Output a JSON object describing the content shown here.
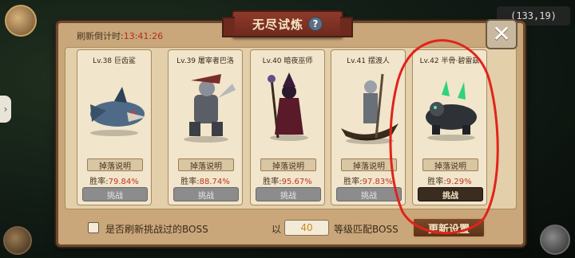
{
  "colors": {
    "accent": "#b42b1a",
    "panel": "#c9a77a",
    "card": "#f1e5cc",
    "annotation": "#e2231a"
  },
  "hud": {
    "coords": "(133,19)"
  },
  "dialog": {
    "title": "无尽试炼",
    "refresh_label": "刷新倒计时:",
    "refresh_time": "13:41:26",
    "close_icon": "close-icon"
  },
  "bosses": [
    {
      "name": "Lv.38 巨齿鲨",
      "drop_label": "掉落说明",
      "win_label": "胜率:",
      "win_rate": "79.84%",
      "challenge_label": "挑战",
      "enabled": false
    },
    {
      "name": "Lv.39 屠宰者巴洛",
      "drop_label": "掉落说明",
      "win_label": "胜率:",
      "win_rate": "88.74%",
      "challenge_label": "挑战",
      "enabled": false
    },
    {
      "name": "Lv.40 暗夜巫师",
      "drop_label": "掉落说明",
      "win_label": "胜率:",
      "win_rate": "95.67%",
      "challenge_label": "挑战",
      "enabled": false
    },
    {
      "name": "Lv.41 摆渡人",
      "drop_label": "掉落说明",
      "win_label": "胜率:",
      "win_rate": "97.83%",
      "challenge_label": "挑战",
      "enabled": false
    },
    {
      "name": "Lv.42 半骨·碧雷兹",
      "drop_label": "掉落说明",
      "win_label": "胜率:",
      "win_rate": "9.29%",
      "challenge_label": "挑战",
      "enabled": true
    }
  ],
  "footer": {
    "refresh_checkbox_label": "是否刷新挑战过的BOSS",
    "prefix": "以",
    "level_value": "40",
    "match_label": "等级匹配BOSS",
    "update_button": "更新设置"
  }
}
